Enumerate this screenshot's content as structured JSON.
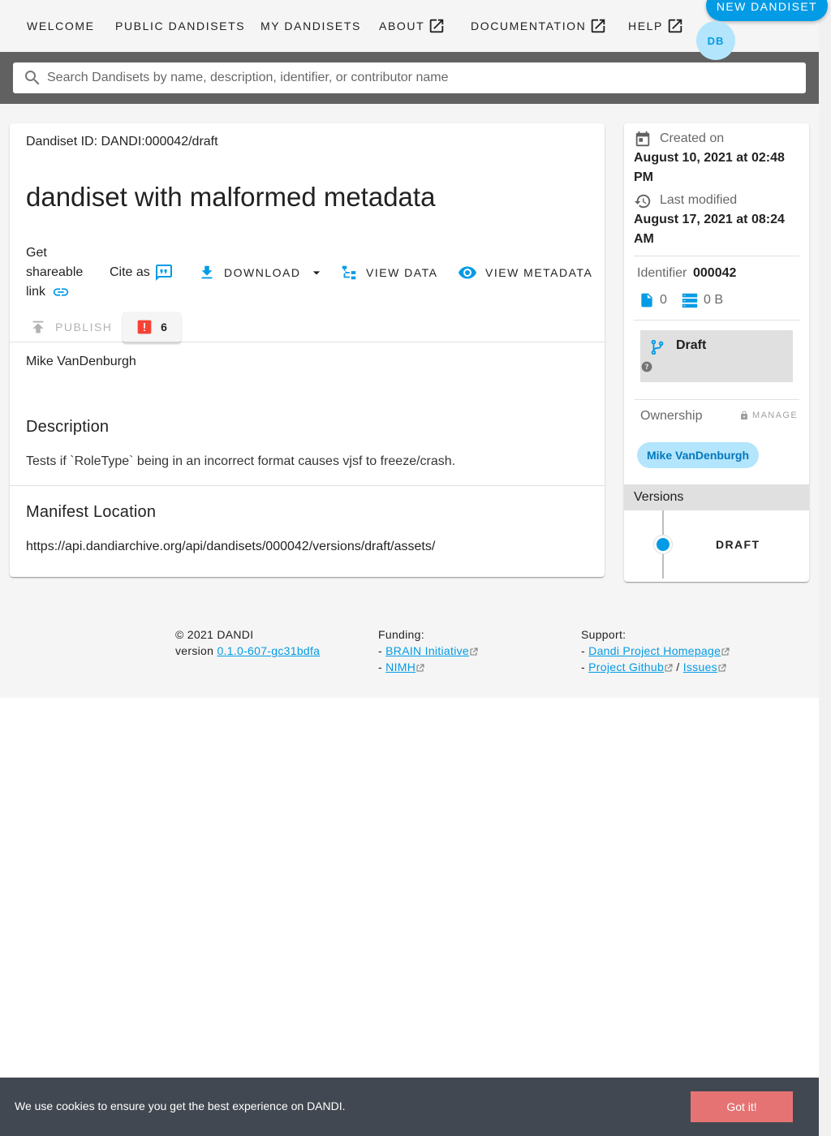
{
  "nav": {
    "welcome": "WELCOME",
    "public_dandisets": "PUBLIC DANDISETS",
    "my_dandisets": "MY DANDISETS",
    "about": "ABOUT",
    "documentation": "DOCUMENTATION",
    "help": "HELP",
    "new_dandiset": "NEW DANDISET",
    "avatar_initials": "DB"
  },
  "search": {
    "placeholder": "Search Dandisets by name, description, identifier, or contributor name"
  },
  "dandiset": {
    "id_line": "Dandiset ID: DANDI:000042/draft",
    "title": "dandiset with malformed metadata",
    "share_link_label": "Get shareable link",
    "cite_label": "Cite as",
    "download_label": "DOWNLOAD",
    "view_data_label": "VIEW DATA",
    "view_metadata_label": "VIEW METADATA",
    "publish_label": "PUBLISH",
    "error_count": "6",
    "contributors": "Mike VanDenburgh",
    "description_title": "Description",
    "description_text": "Tests if `RoleType` being in an incorrect format causes vjsf to freeze/crash.",
    "manifest_title": "Manifest Location",
    "manifest_url": "https://api.dandiarchive.org/api/dandisets/000042/versions/draft/assets/"
  },
  "sidebar": {
    "created_label": "Created on",
    "created_value": "August 10, 2021 at 02:48 PM",
    "modified_label": "Last modified",
    "modified_value": "August 17, 2021 at 08:24 AM",
    "identifier_label": "Identifier",
    "identifier_value": "000042",
    "file_count": "0",
    "size": "0 B",
    "draft_label": "Draft",
    "ownership_label": "Ownership",
    "manage_label": "MANAGE",
    "owner": "Mike VanDenburgh",
    "versions_label": "Versions",
    "version_draft": "DRAFT"
  },
  "footer": {
    "copyright": "© 2021 DANDI",
    "version_prefix": "version",
    "version_value": "0.1.0-607-gc31bdfa",
    "funding_label": "Funding:",
    "funding_link_1": "BRAIN Initiative",
    "funding_link_2": "NIMH",
    "support_label": "Support:",
    "support_link_1": "Dandi Project Homepage",
    "support_link_2": "Project Github",
    "support_separator": "/",
    "support_link_3": "Issues"
  },
  "cookie": {
    "message": "We use cookies to ensure you get the best experience on DANDI.",
    "button": "Got it!"
  },
  "colors": {
    "accent": "#039be5",
    "error": "#f44336",
    "cookie_button": "#e57373"
  }
}
